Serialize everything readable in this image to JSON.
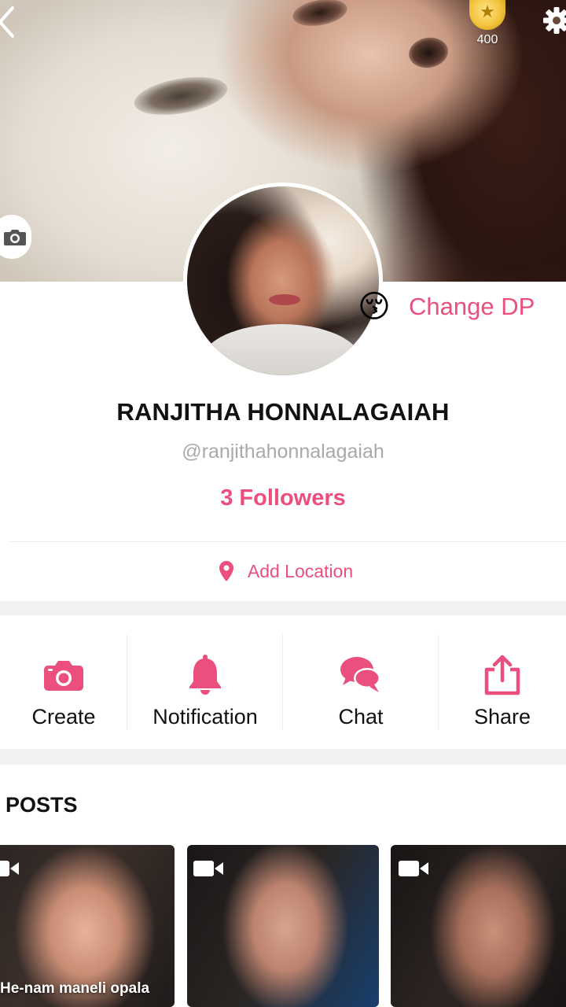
{
  "header": {
    "coins": "400"
  },
  "profile": {
    "change_dp_label": "Change DP",
    "avatar_emoji": "😚",
    "name": "RANJITHA HONNALAGAIAH",
    "handle": "@ranjithahonnalagaiah",
    "followers": "3 Followers",
    "add_location": "Add Location"
  },
  "actions": [
    {
      "label": "Create",
      "icon": "camera-icon"
    },
    {
      "label": "Notification",
      "icon": "bell-icon"
    },
    {
      "label": "Chat",
      "icon": "chat-bubbles-icon"
    },
    {
      "label": "Share",
      "icon": "share-icon"
    }
  ],
  "posts": {
    "title": "POSTS",
    "items": [
      {
        "type": "video",
        "caption": "He-nam maneli opala"
      },
      {
        "type": "video",
        "caption": ""
      },
      {
        "type": "video",
        "caption": ""
      }
    ]
  },
  "colors": {
    "accent": "#ea4f7e",
    "text": "#111111",
    "muted": "#a9a9a9",
    "band": "#f1f1f1"
  }
}
